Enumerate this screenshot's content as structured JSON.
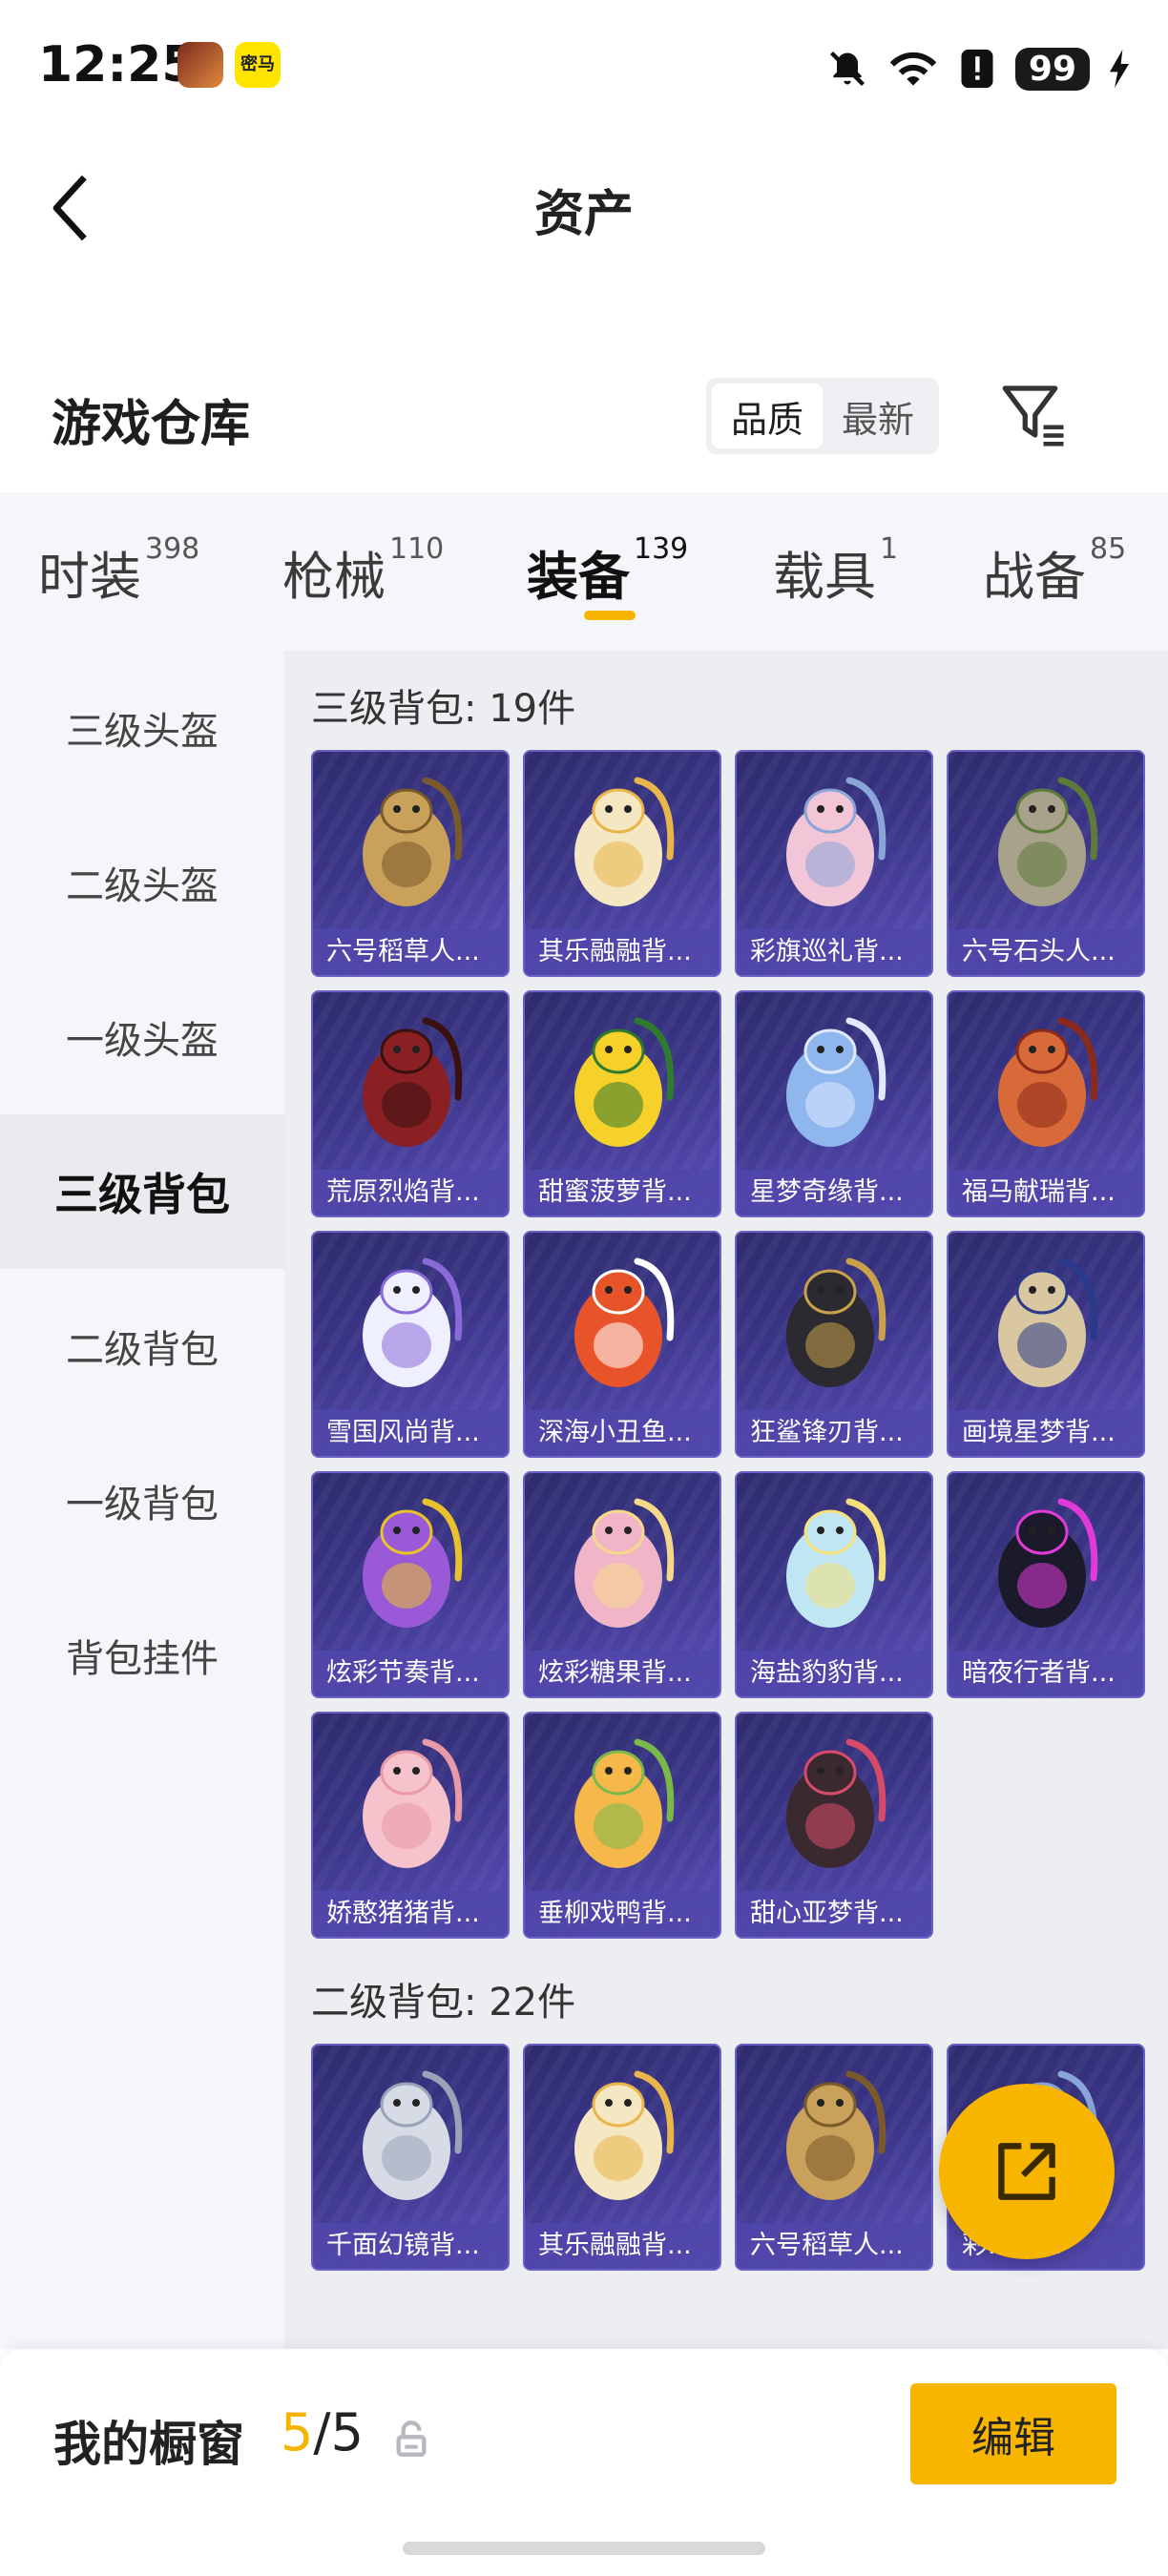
{
  "status_bar": {
    "time": "12:25",
    "app_icons": [
      "game-hero-icon",
      "mima-app-icon"
    ],
    "mima_label": "密马",
    "battery": "99"
  },
  "header": {
    "title": "资产",
    "back_icon": "back-chevron-icon"
  },
  "warehouse": {
    "title": "游戏仓库",
    "sort_options": [
      "品质",
      "最新"
    ],
    "sort_selected": "品质",
    "filter_icon": "filter-icon"
  },
  "tabs": [
    {
      "label": "时装",
      "count": "398"
    },
    {
      "label": "枪械",
      "count": "110"
    },
    {
      "label": "装备",
      "count": "139"
    },
    {
      "label": "载具",
      "count": "1"
    },
    {
      "label": "战备",
      "count": "85"
    }
  ],
  "active_tab": "装备",
  "sidebar": {
    "items": [
      "三级头盔",
      "二级头盔",
      "一级头盔",
      "三级背包",
      "二级背包",
      "一级背包",
      "背包挂件"
    ],
    "active": "三级背包"
  },
  "sections": [
    {
      "title": "三级背包: 19件",
      "items": [
        {
          "name": "六号稻草人...",
          "art": "scarecrow"
        },
        {
          "name": "其乐融融背...",
          "art": "cream"
        },
        {
          "name": "彩旗巡礼背...",
          "art": "festival"
        },
        {
          "name": "六号石头人...",
          "art": "stone"
        },
        {
          "name": "荒原烈焰背...",
          "art": "flame"
        },
        {
          "name": "甜蜜菠萝背...",
          "art": "pineapple"
        },
        {
          "name": "星梦奇缘背...",
          "art": "swan"
        },
        {
          "name": "福马献瑞背...",
          "art": "horse"
        },
        {
          "name": "雪国风尚背...",
          "art": "penguin"
        },
        {
          "name": "深海小丑鱼...",
          "art": "clownfish"
        },
        {
          "name": "狂鲨锋刃背...",
          "art": "shark"
        },
        {
          "name": "画境星梦背...",
          "art": "frame"
        },
        {
          "name": "炫彩节奏背...",
          "art": "rhythm"
        },
        {
          "name": "炫彩糖果背...",
          "art": "candy"
        },
        {
          "name": "海盐豹豹背...",
          "art": "seal"
        },
        {
          "name": "暗夜行者背...",
          "art": "night"
        },
        {
          "name": "娇憨猪猪背...",
          "art": "pig"
        },
        {
          "name": "垂柳戏鸭背...",
          "art": "duck"
        },
        {
          "name": "甜心亚梦背...",
          "art": "heart"
        }
      ]
    },
    {
      "title": "二级背包: 22件",
      "items": [
        {
          "name": "千面幻镜背...",
          "art": "mirror"
        },
        {
          "name": "其乐融融背...",
          "art": "cream"
        },
        {
          "name": "六号稻草人...",
          "art": "scarecrow"
        },
        {
          "name": "彩...背...",
          "art": "festival"
        }
      ]
    }
  ],
  "fab_icon": "share-export-icon",
  "bottom_bar": {
    "title": "我的橱窗",
    "current": "5",
    "separator": "/",
    "total": "5",
    "lock_icon": "unlock-icon",
    "edit_label": "编辑"
  },
  "colors": {
    "accent": "#f7b500",
    "card_bg": "#3b3588",
    "card_label_bg": "#5046aa",
    "sidebar_bg": "#f4f6f9",
    "content_bg": "#eceef1"
  }
}
